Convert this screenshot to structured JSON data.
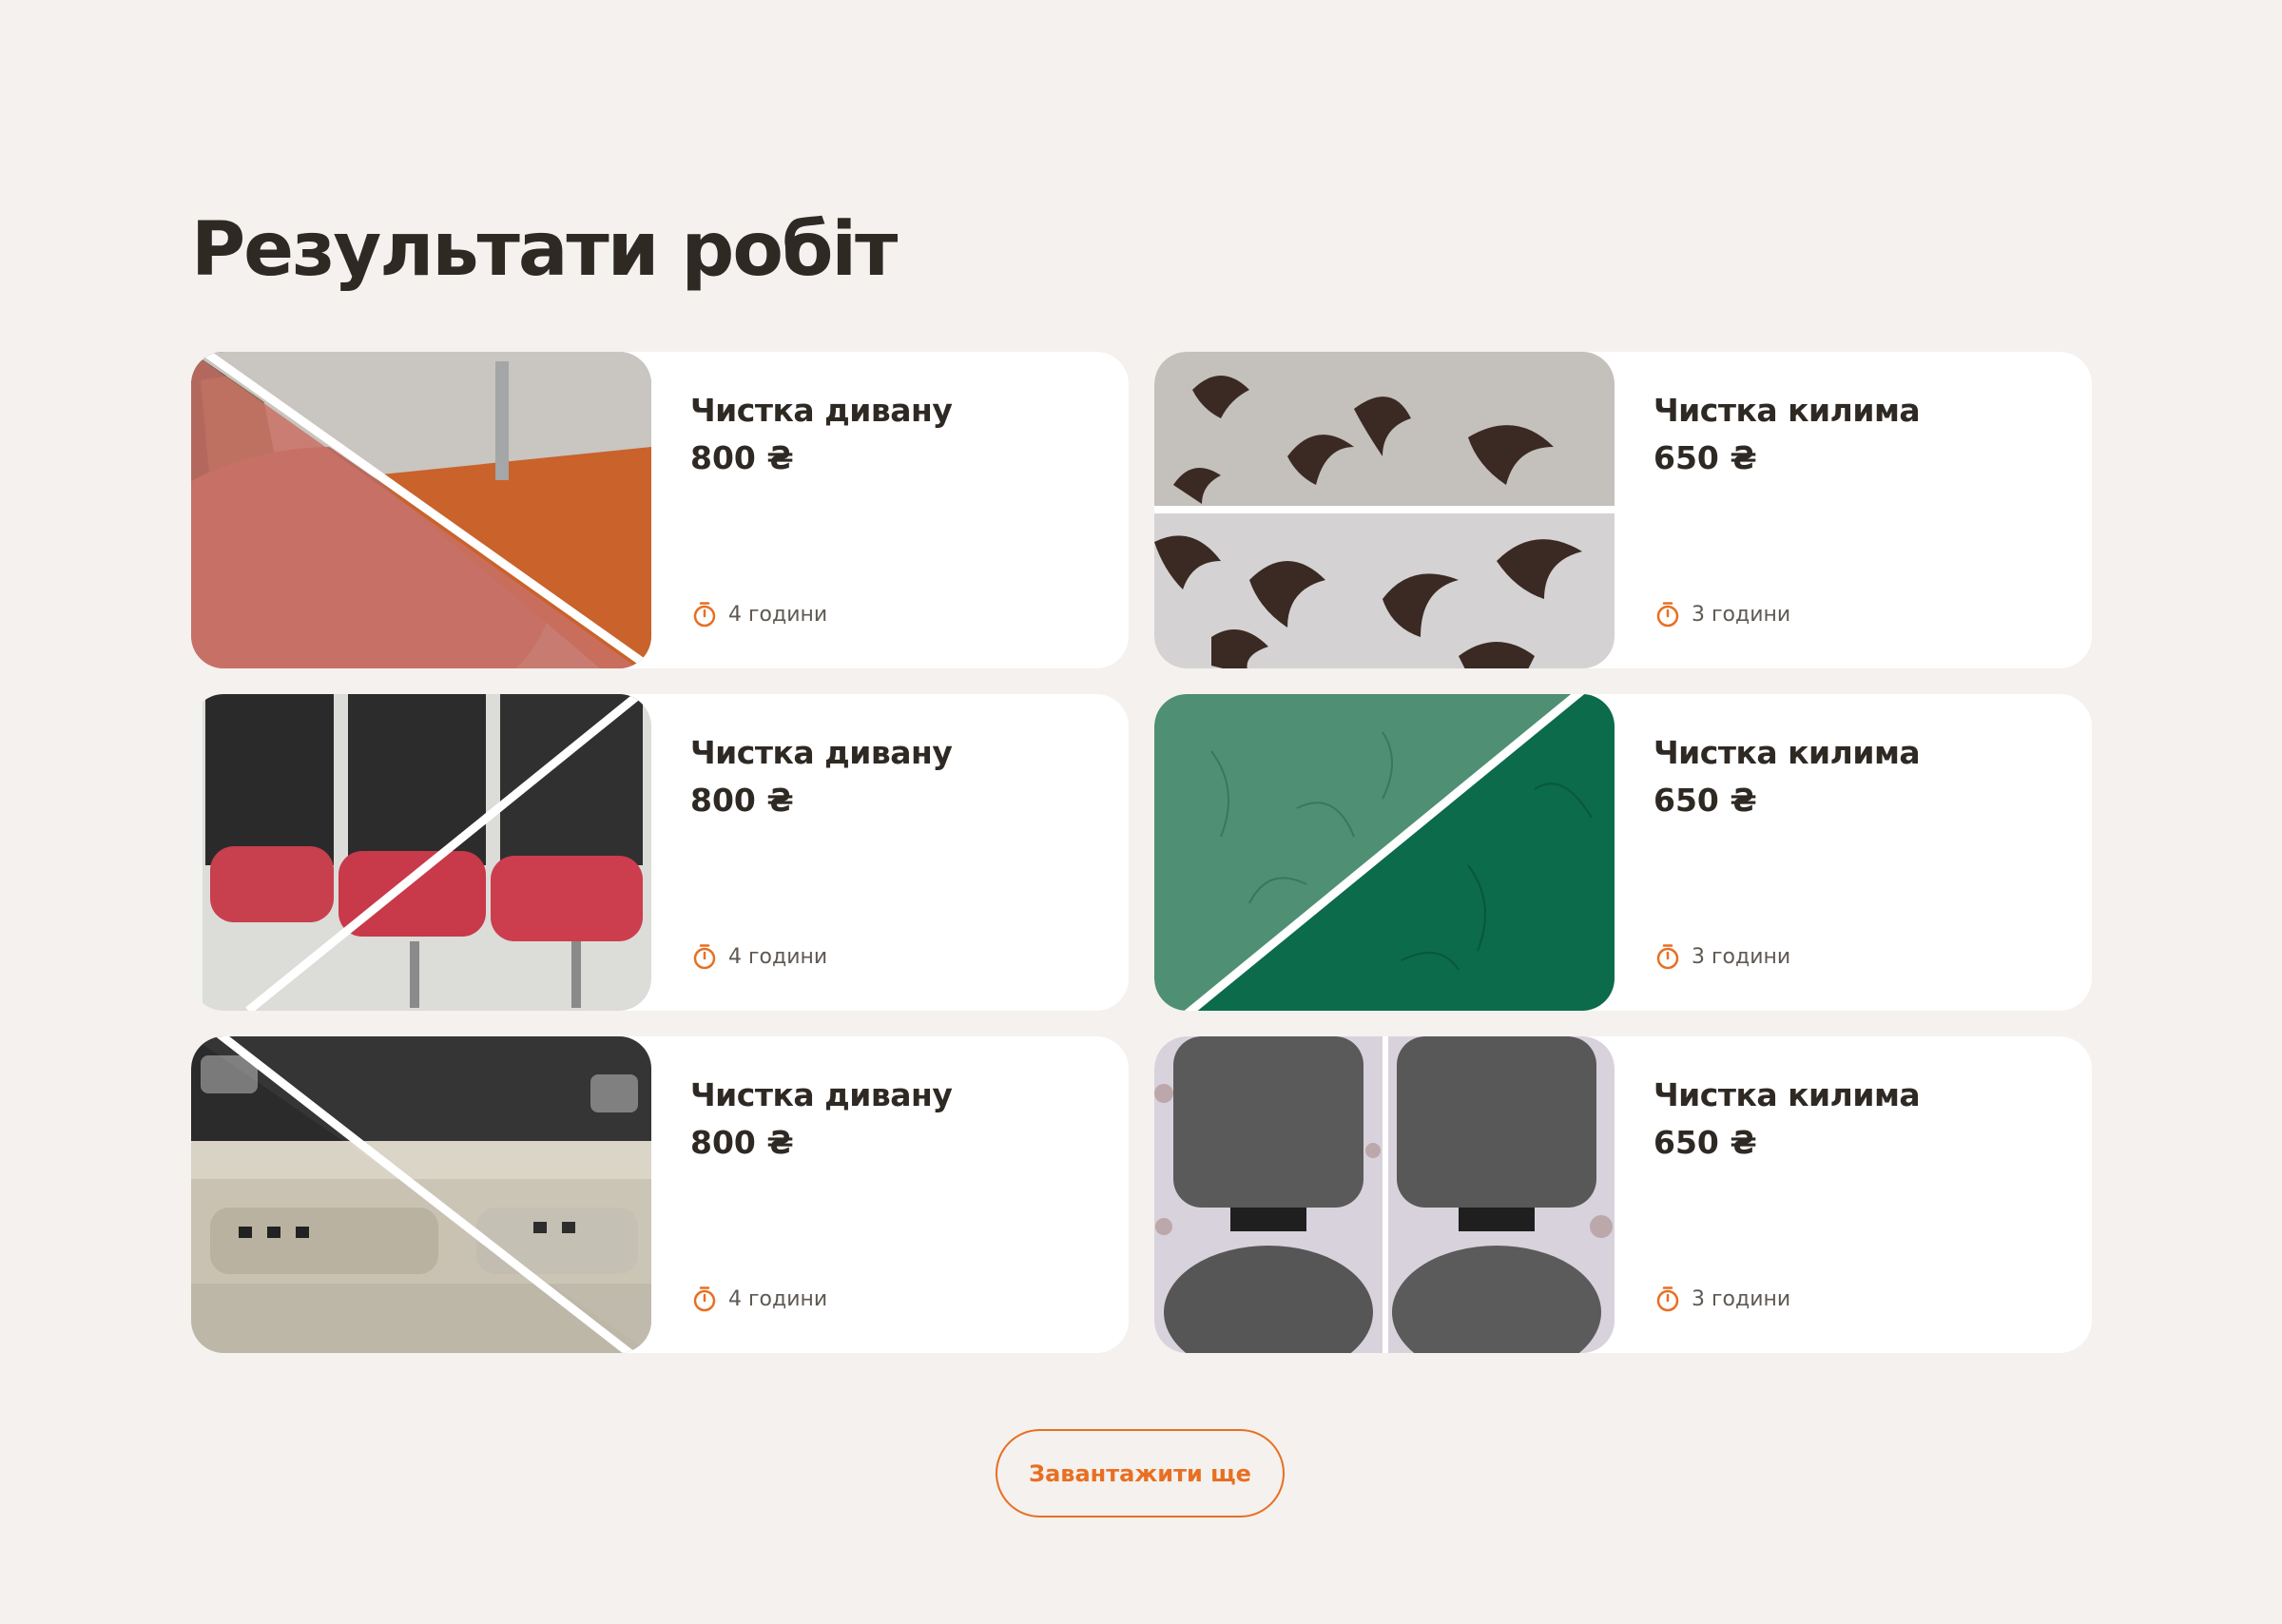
{
  "section": {
    "title": "Результати робіт"
  },
  "cards": [
    {
      "title": "Чистка дивану",
      "price": "800 ₴",
      "duration": "4 години",
      "photo": "office-chair-seat-before-after"
    },
    {
      "title": "Чистка килима",
      "price": "650 ₴",
      "duration": "3 години",
      "photo": "patterned-carpet-before-after"
    },
    {
      "title": "Чистка дивану",
      "price": "800 ₴",
      "duration": "4 години",
      "photo": "red-chairs-before-after"
    },
    {
      "title": "Чистка килима",
      "price": "650 ₴",
      "duration": "3 години",
      "photo": "green-fabric-before-after"
    },
    {
      "title": "Чистка дивану",
      "price": "800 ₴",
      "duration": "4 години",
      "photo": "car-door-panel-before-after"
    },
    {
      "title": "Чистка килима",
      "price": "650 ₴",
      "duration": "3 години",
      "photo": "office-chair-back-before-after"
    }
  ],
  "actions": {
    "load_more_label": "Завантажити ще"
  },
  "icons": {
    "timer": "stopwatch-icon"
  },
  "colors": {
    "background": "#f4f1ee",
    "card": "#ffffff",
    "text": "#2f2924",
    "accent": "#e86f22"
  }
}
